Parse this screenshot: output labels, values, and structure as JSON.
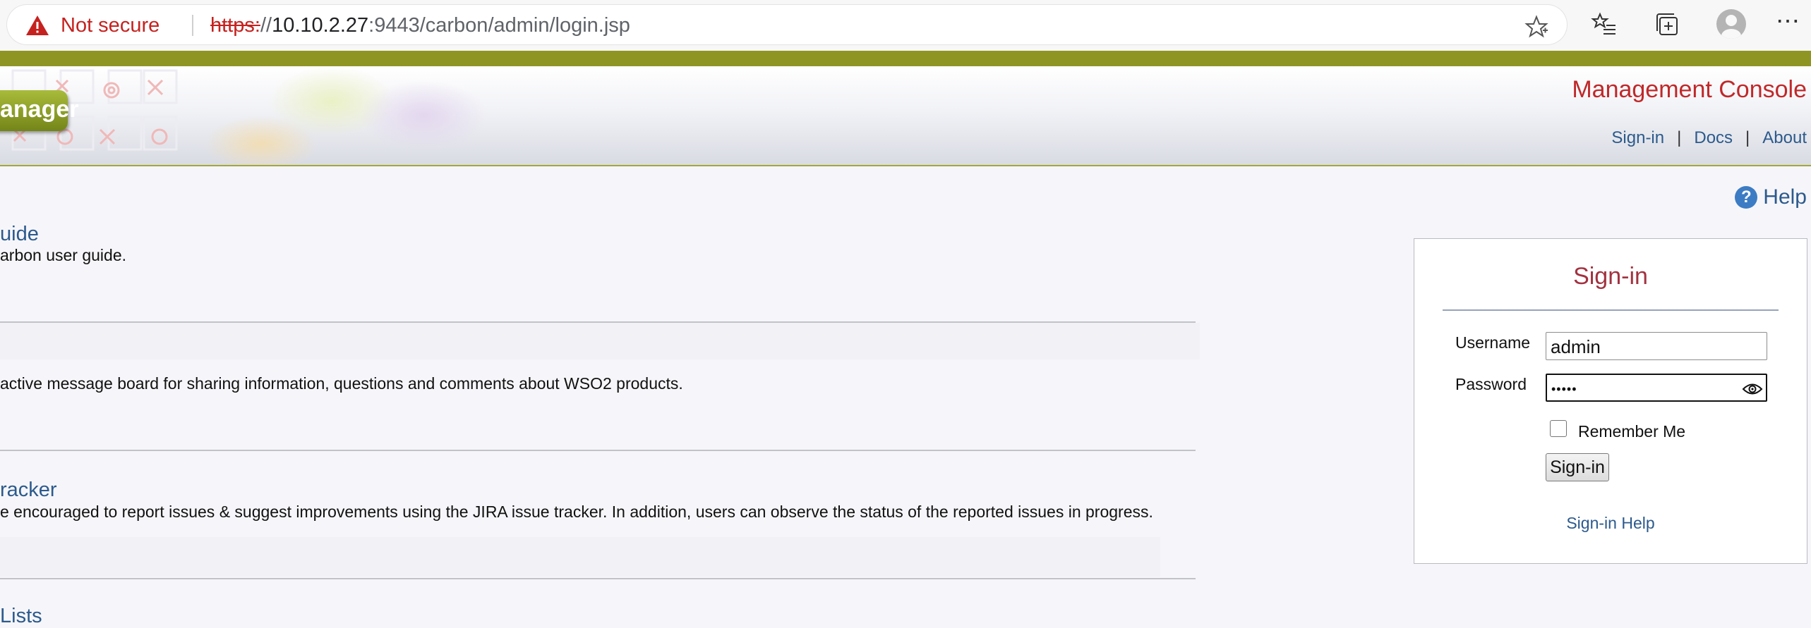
{
  "browser": {
    "security_label": "Not secure",
    "url_protocol": "https:",
    "url_slashes": "//",
    "url_host": "10.10.2.27",
    "url_rest": ":9443/carbon/admin/login.jsp"
  },
  "header": {
    "logo_text": "anager",
    "title": "Management Console",
    "links": {
      "signin": "Sign-in",
      "docs": "Docs",
      "about": "About",
      "separator": "|"
    }
  },
  "help_label": "Help",
  "sections": [
    {
      "title": "uide",
      "text": "arbon user guide."
    },
    {
      "title": "",
      "text": "active message board for sharing information, questions and comments about WSO2 products."
    },
    {
      "title": "racker",
      "text": "e encouraged to report issues & suggest improvements using the JIRA issue tracker. In addition, users can observe the status of the reported issues in progress."
    },
    {
      "title": "Lists",
      "text": ""
    }
  ],
  "login": {
    "title": "Sign-in",
    "username_label": "Username",
    "username_value": "admin",
    "password_label": "Password",
    "password_value": "•••••",
    "remember_label": "Remember Me",
    "button_label": "Sign-in",
    "help_link": "Sign-in Help"
  },
  "colors": {
    "accent_olive": "#8f9523",
    "title_red": "#c0282a",
    "link_blue": "#2c5a8c",
    "signin_title": "#a23240"
  }
}
